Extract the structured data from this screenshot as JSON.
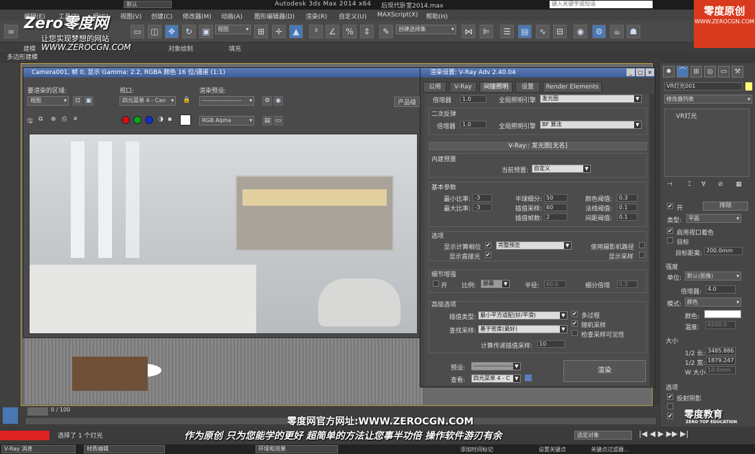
{
  "window": {
    "title": "Autodesk 3ds Max  2014 x64",
    "file": "后现代卧室2014.max",
    "workspace_label": "工作区:",
    "workspace_value": "默认",
    "help_search": "键入关键字或短语"
  },
  "menu": [
    "编辑(E)",
    "工具(T)",
    "组(G)",
    "视图(V)",
    "创建(C)",
    "修改器(M)",
    "动画(A)",
    "图形编辑器(D)",
    "渲染(R)",
    "自定义(U)",
    "MAXScript(X)",
    "帮助(H)"
  ],
  "toolbar": {
    "view_dropdown": "视图",
    "selection_set": "创建选择集"
  },
  "ribbon": {
    "tabs": [
      "建模",
      "对象绘制",
      "填充"
    ],
    "sub": "多边形建模"
  },
  "render_frame": {
    "title": "Camera001, 帧 0, 显示 Gamma: 2.2, RGBA 颜色 16 位/通道 (1:1)",
    "area_label": "要渲染的区域:",
    "area_value": "视图",
    "viewport_label": "视口:",
    "viewport_value": "四元菜单 4 - Can",
    "preset_label": "渲染预设:",
    "preset_value": "--------------------",
    "channel_value": "RGB Alpha",
    "right_button": "产品级",
    "swatch_colors": [
      "#d01010",
      "#10a020",
      "#1030d0",
      "#ffffff"
    ]
  },
  "render_settings": {
    "title": "渲染设置: V-Ray Adv 2.40.04",
    "tabs": [
      "公用",
      "V-Ray",
      "间接照明",
      "设置",
      "Render Elements"
    ],
    "active_tab": "间接照明",
    "primary": {
      "multiplier_label": "倍增器",
      "multiplier": "1.0",
      "engine_label": "全局照明引擎",
      "engine": "发光图"
    },
    "secondary": {
      "title": "二次反弹",
      "multiplier_label": "倍增器",
      "multiplier": "1.0",
      "engine_label": "全局照明引擎",
      "engine": "BF 算法"
    },
    "irradiance_header": "V-Ray:: 发光图[无名]",
    "builtin_preset": {
      "title": "内建预置",
      "current_label": "当前预置:",
      "current": "自定义"
    },
    "basic": {
      "title": "基本参数",
      "min_rate_label": "最小比率:",
      "min_rate": "-3",
      "max_rate_label": "最大比率:",
      "max_rate": "-3",
      "hsph_label": "半球细分:",
      "hsph": "50",
      "interp_label": "插值采样:",
      "interp": "60",
      "interp_frames_label": "插值帧数:",
      "interp_frames": "2",
      "clr_label": "颜色阈值:",
      "clr": "0.3",
      "nrm_label": "法线阈值:",
      "nrm": "0.1",
      "dist_label": "间距阈值:",
      "dist": "0.1"
    },
    "options": {
      "title": "选项",
      "show_calc_label": "显示计算相位",
      "show_calc_mode": "完整预览",
      "show_direct_label": "显示直接光",
      "use_camera_label": "使用摄影机路径",
      "show_samples_label": "显示采样"
    },
    "detail": {
      "title": "细节增强",
      "on_label": "开",
      "scale_label": "比例:",
      "scale": "屏幕",
      "radius_label": "半径:",
      "radius": "60.0",
      "mult_label": "细分倍增",
      "mult": "0.3"
    },
    "advanced": {
      "title": "高级选项",
      "interp_type_label": "插值类型:",
      "interp_type": "最小平方适配(好/平滑)",
      "lookup_label": "查找采样:",
      "lookup": "基于密度(最好)",
      "calc_pass_label": "计算传递插值采样:",
      "calc_pass": "10",
      "multipass_label": "多过程",
      "randomize_label": "随机采样",
      "check_vis_label": "检查采样可见性"
    },
    "footer": {
      "preset_label": "预设:",
      "preset": "--------------------",
      "view_label": "查看:",
      "view": "四元菜单 4 - C",
      "render_button": "渲染"
    }
  },
  "command_panel": {
    "object_name": "VR灯光001",
    "modifier_list": "修改器列表",
    "stack_item": "VR灯光",
    "general": {
      "on_label": "开",
      "exclude_button": "排除",
      "type_label": "类型:",
      "type_value": "平面",
      "enable_vp_label": "启用视口着色",
      "target_label": "目标",
      "target_dist_label": "目标距离:",
      "target_dist": "200.0mm"
    },
    "intensity": {
      "title": "强度",
      "units_label": "单位:",
      "units": "默认(图像)",
      "mult_label": "倍增器:",
      "mult": "4.0",
      "mode_label": "模式:",
      "mode": "颜色",
      "color_label": "颜色:",
      "color": "#ffffff",
      "temp_label": "温度:",
      "temp": "6500.0"
    },
    "size": {
      "title": "大小",
      "half_len_label": "1/2 长:",
      "half_len": "3485.886",
      "half_wid_label": "1/2 宽:",
      "half_wid": "1879.247",
      "w_label": "W 大小",
      "w": "10.0mm"
    },
    "options": {
      "title": "选项",
      "cast_shadows_label": "投射阴影"
    }
  },
  "timeline": {
    "frame": "0 / 100"
  },
  "status": {
    "selected": "选择了 1 个灯光",
    "select_object": "选定对象",
    "add_time_tag": "添加时间标记",
    "set_key": "设置关键点",
    "key_filter": "关键点过滤器..."
  },
  "taskbar": [
    "V-Ray 消息",
    "材质编辑",
    "环境和效果"
  ],
  "overlay": {
    "logo": "Zero零度网",
    "logo_sub": "让您实现梦想的网站",
    "logo_url": "WWW.ZEROCGN.COM",
    "corner": "零度原创",
    "corner_url": "WWW.ZEROCGN.COM",
    "subtitle_url": "零度网官方网址:WWW.ZEROCGN.COM",
    "subtitle_line": "作为原创 只为您能学的更好 超简单的方法让您事半功倍 操作软件游刃有余",
    "edu": "零度教育",
    "edu_sub": "ZERO TOP EDUCATION"
  }
}
